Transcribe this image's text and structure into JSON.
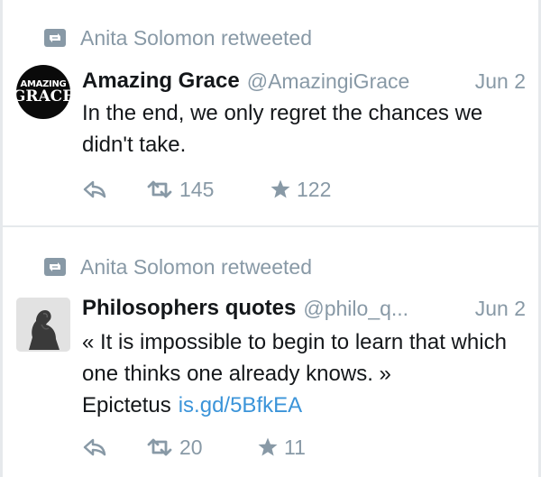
{
  "tweets": [
    {
      "retweeted_by": "Anita Solomon retweeted",
      "avatar": {
        "icon": "amazing-grace-logo",
        "line1": "AMAZING",
        "line2": "GRACE"
      },
      "name": "Amazing Grace",
      "handle": "@AmazingiGrace",
      "date": "Jun 2",
      "text": "In the end, we only regret the chances we didn't take.",
      "link": "",
      "retweets": "145",
      "favorites": "122"
    },
    {
      "retweeted_by": "Anita Solomon retweeted",
      "avatar": {
        "icon": "thinker-statue-photo"
      },
      "name": "Philosophers quotes",
      "handle": "@philo_q...",
      "date": "Jun 2",
      "text": "« It is impossible to begin to learn that which one thinks one already knows. » Epictetus",
      "link": "is.gd/5BfkEA",
      "retweets": "20",
      "favorites": "11"
    }
  ],
  "colors": {
    "muted": "#8899a6",
    "link": "#3b94d9",
    "text": "#14171a",
    "divider": "#e6e9ec"
  }
}
